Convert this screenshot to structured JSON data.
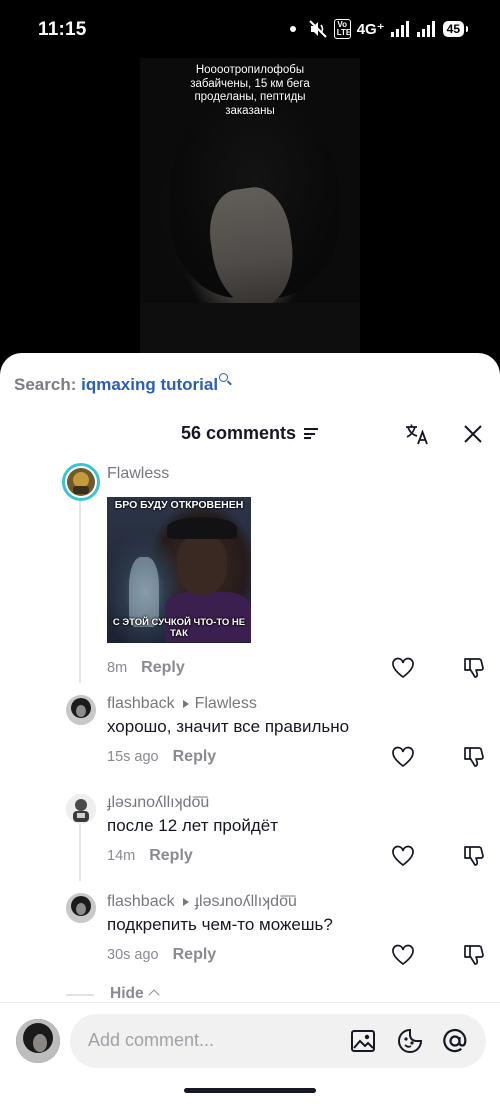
{
  "status_bar": {
    "time": "11:15",
    "volte": "Vo\nLTE",
    "network": "4G⁺",
    "battery": "45"
  },
  "video": {
    "caption": "Ноооотропилофобы забайчены, 15 км бега проделаны, пептиды заказаны"
  },
  "search": {
    "prefix": "Search:",
    "term": "iqmaxing tutorial"
  },
  "comments_header": {
    "title": "56 comments"
  },
  "comments": [
    {
      "author": "Flawless",
      "image_top_text": "БРО БУДУ ОТКРОВЕНЕН",
      "image_bottom_text": "С ЭТОЙ СУЧКОЙ ЧТО-ТО НЕ ТАК",
      "time": "8m",
      "reply_label": "Reply"
    },
    {
      "author": "flashback",
      "reply_to": "Flawless",
      "text": "хорошо, значит все правильно",
      "time": "15s ago",
      "reply_label": "Reply"
    },
    {
      "author": "ɟlǝsɹnoʎllıʞdo͞u",
      "text": "после 12 лет пройдёт",
      "time": "14m",
      "reply_label": "Reply"
    },
    {
      "author": "flashback",
      "reply_to": "ɟlǝsɹnoʎllıʞdo͞u",
      "text": "подкрепить чем-то можешь?",
      "time": "30s ago",
      "reply_label": "Reply"
    }
  ],
  "hide_label": "Hide",
  "composer": {
    "placeholder": "Add comment..."
  },
  "icons": {
    "search": "magnifier-icon",
    "filter": "filter-icon",
    "translate": "translate-icon",
    "close": "close-icon",
    "like": "heart-icon",
    "dislike": "thumbs-down-icon",
    "image": "image-icon",
    "emoji": "emoji-icon",
    "mention": "at-icon"
  },
  "colors": {
    "accent_link": "#2b5eb8",
    "text_primary": "#161823",
    "text_secondary": "#8a8b91",
    "avatar_ring": "#36c5d8"
  }
}
